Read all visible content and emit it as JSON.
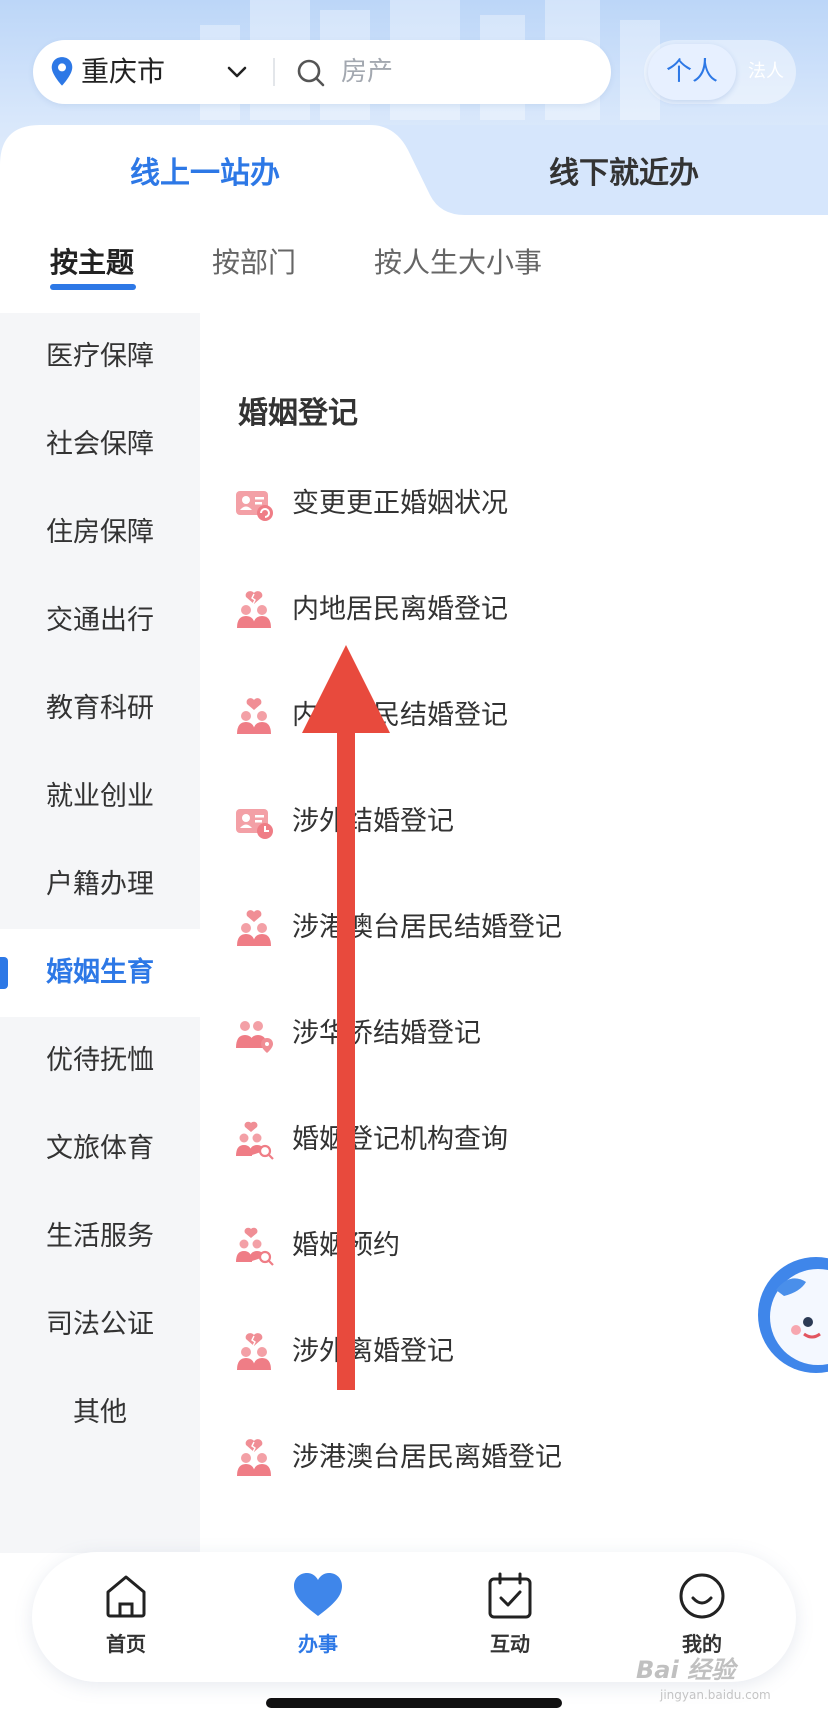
{
  "header": {
    "city": "重庆市",
    "search_placeholder": "房产",
    "toggle": {
      "personal": "个人",
      "legal": "法人"
    }
  },
  "service_mode_tabs": {
    "online": "线上一站办",
    "offline": "线下就近办"
  },
  "sub_tabs": [
    "按主题",
    "按部门",
    "按人生大小事"
  ],
  "sidebar": {
    "items": [
      "医疗保障",
      "社会保障",
      "住房保障",
      "交通出行",
      "教育科研",
      "就业创业",
      "户籍办理",
      "婚姻生育",
      "优待抚恤",
      "文旅体育",
      "生活服务",
      "司法公证",
      "其他"
    ],
    "active_index": 7
  },
  "content": {
    "section_title": "婚姻登记",
    "services": [
      {
        "label": "变更更正婚姻状况",
        "icon": "id-card-refresh-icon"
      },
      {
        "label": "内地居民离婚登记",
        "icon": "couple-broken-heart-icon"
      },
      {
        "label": "内地居民结婚登记",
        "icon": "couple-heart-icon"
      },
      {
        "label": "涉外结婚登记",
        "icon": "id-card-clock-icon"
      },
      {
        "label": "涉港澳台居民结婚登记",
        "icon": "couple-heart-icon"
      },
      {
        "label": "涉华侨结婚登记",
        "icon": "couple-location-icon"
      },
      {
        "label": "婚姻登记机构查询",
        "icon": "couple-search-icon"
      },
      {
        "label": "婚姻预约",
        "icon": "couple-search-icon"
      },
      {
        "label": "涉外离婚登记",
        "icon": "couple-broken-heart-icon"
      },
      {
        "label": "涉港澳台居民离婚登记",
        "icon": "couple-broken-heart-icon"
      }
    ]
  },
  "bottom_nav": [
    {
      "label": "首页",
      "icon": "home-icon"
    },
    {
      "label": "办事",
      "icon": "heart-icon"
    },
    {
      "label": "互动",
      "icon": "calendar-check-icon"
    },
    {
      "label": "我的",
      "icon": "smile-icon"
    }
  ],
  "colors": {
    "accent": "#2d78e6",
    "service_icon": "#ef8c93",
    "annotation_arrow": "#e84a3d"
  },
  "watermark": {
    "text": "Bai 经验",
    "sub": "jingyan.baidu.com"
  }
}
